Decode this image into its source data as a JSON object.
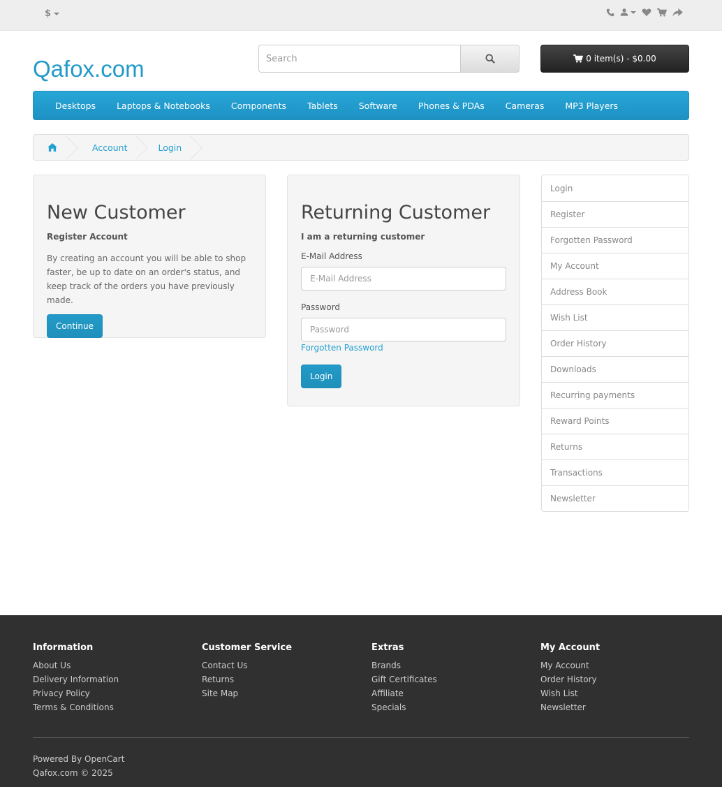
{
  "topbar": {
    "currency": "$",
    "icons": [
      "phone-icon",
      "user-icon",
      "heart-icon",
      "cart-icon",
      "share-icon"
    ]
  },
  "header": {
    "logo": "Qafox.com",
    "search_placeholder": "Search",
    "cart_label": "0 item(s) - $0.00"
  },
  "menu": {
    "items": [
      "Desktops",
      "Laptops & Notebooks",
      "Components",
      "Tablets",
      "Software",
      "Phones & PDAs",
      "Cameras",
      "MP3 Players"
    ]
  },
  "breadcrumb": {
    "items": [
      "Account",
      "Login"
    ]
  },
  "new_customer": {
    "title": "New Customer",
    "subtitle": "Register Account",
    "text": "By creating an account you will be able to shop faster, be up to date on an order's status, and keep track of the orders you have previously made.",
    "button": "Continue"
  },
  "returning_customer": {
    "title": "Returning Customer",
    "subtitle": "I am a returning customer",
    "email_label": "E-Mail Address",
    "email_placeholder": "E-Mail Address",
    "password_label": "Password",
    "password_placeholder": "Password",
    "forgot_link": "Forgotten Password",
    "button": "Login"
  },
  "sidebar": {
    "items": [
      "Login",
      "Register",
      "Forgotten Password",
      "My Account",
      "Address Book",
      "Wish List",
      "Order History",
      "Downloads",
      "Recurring payments",
      "Reward Points",
      "Returns",
      "Transactions",
      "Newsletter"
    ]
  },
  "footer": {
    "information": {
      "title": "Information",
      "links": [
        "About Us",
        "Delivery Information",
        "Privacy Policy",
        "Terms & Conditions"
      ]
    },
    "customer_service": {
      "title": "Customer Service",
      "links": [
        "Contact Us",
        "Returns",
        "Site Map"
      ]
    },
    "extras": {
      "title": "Extras",
      "links": [
        "Brands",
        "Gift Certificates",
        "Affiliate",
        "Specials"
      ]
    },
    "my_account": {
      "title": "My Account",
      "links": [
        "My Account",
        "Order History",
        "Wish List",
        "Newsletter"
      ]
    },
    "powered_prefix": "Powered By",
    "powered_link": "OpenCart",
    "copyright": "Qafox.com © 2025"
  }
}
